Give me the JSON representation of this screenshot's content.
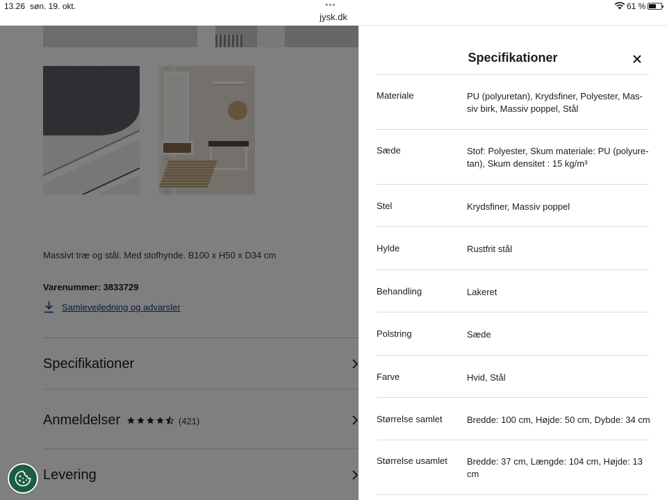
{
  "status_bar": {
    "time": "13.26",
    "date": "søn. 19. okt.",
    "dots": "•••",
    "url": "jysk.dk",
    "battery": "61 %",
    "battery_level": 0.61
  },
  "product": {
    "description": "Massivt træ og stål. Med stofhynde. B100 x H50 x D34 cm",
    "sku": "Varenummer: 3833729",
    "download_link": "Samlevejledning og advarsler"
  },
  "accordion": {
    "specs": "Specifikationer",
    "reviews": "Anmeldelser",
    "review_count": "(421)",
    "rating": 4.5,
    "delivery": "Levering"
  },
  "panel": {
    "title": "Specifikationer",
    "rows": [
      {
        "label": "Materiale",
        "value": "PU (polyuretan), Krydsfiner, Polyester, Mas­siv birk, Massiv poppel, Stål"
      },
      {
        "label": "Sæde",
        "value": "Stof: Polyester, Skum materiale: PU (polyure­tan), Skum densitet : 15 kg/m³"
      },
      {
        "label": "Stel",
        "value": "Krydsfiner, Massiv poppel"
      },
      {
        "label": "Hylde",
        "value": "Rustfrit stål"
      },
      {
        "label": "Behandling",
        "value": "Lakeret"
      },
      {
        "label": "Polstring",
        "value": "Sæde"
      },
      {
        "label": "Farve",
        "value": "Hvid, Stål"
      },
      {
        "label": "Størrelse samlet",
        "value": "Bredde: 100 cm, Højde: 50 cm, Dybde: 34 cm"
      },
      {
        "label": "Størrelse usamlet",
        "value": "Bredde: 37 cm, Længde: 104 cm, Højde: 13 cm"
      }
    ]
  },
  "colors": {
    "link": "#0c3e8a",
    "cookie_button": "#1c5d3e",
    "divider": "#dcdcdc"
  },
  "icons": {
    "close": "close-icon",
    "download": "download-icon",
    "chevron": "chevron-right-icon",
    "cookie": "cookie-icon"
  }
}
